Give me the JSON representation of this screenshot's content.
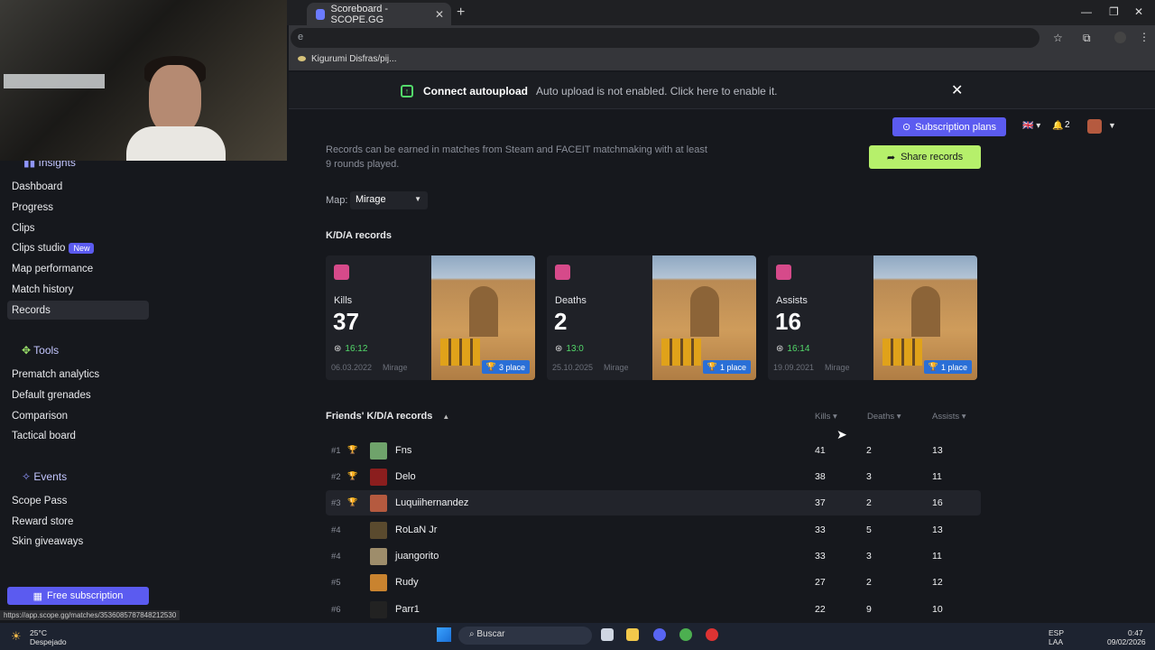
{
  "browser": {
    "tab_title": "Scoreboard - SCOPE.GG",
    "url": "e",
    "bookmark": "Kigurumi Disfras/pij...",
    "status_url": "https://app.scope.gg/matches/3536085787848212530"
  },
  "banner": {
    "title": "Connect autoupload",
    "text": "Auto upload is not enabled. Click here to enable it."
  },
  "header": {
    "subscription_label": "Subscription plans",
    "notifications": "2"
  },
  "sidebar": {
    "insights_label": "Insights",
    "items": [
      "Dashboard",
      "Progress",
      "Clips",
      "Clips studio",
      "Map performance",
      "Match history",
      "Records"
    ],
    "new_badge": "New",
    "tools_label": "Tools",
    "tools": [
      "Prematch analytics",
      "Default grenades",
      "Comparison",
      "Tactical board"
    ],
    "events_label": "Events",
    "events": [
      "Scope Pass",
      "Reward store",
      "Skin giveaways"
    ],
    "free_sub_label": "Free subscription"
  },
  "main": {
    "description": "Records can be earned in matches from Steam and FACEIT matchmaking with at least 9 rounds played.",
    "share_label": "Share records",
    "map_label": "Map:",
    "map_value": "Mirage",
    "kda_title": "K/D/A records",
    "cards": [
      {
        "label": "Kills",
        "value": "37",
        "time": "16:12",
        "date": "06.03.2022",
        "map": "Mirage",
        "place": "3 place",
        "icon_color": "#d64a8a"
      },
      {
        "label": "Deaths",
        "value": "2",
        "time": "13:0",
        "date": "25.10.2025",
        "map": "Mirage",
        "place": "1 place",
        "icon_color": "#d64a8a"
      },
      {
        "label": "Assists",
        "value": "16",
        "time": "16:14",
        "date": "19.09.2021",
        "map": "Mirage",
        "place": "1 place",
        "icon_color": "#d64a8a"
      }
    ],
    "friends_title": "Friends' K/D/A records",
    "columns": [
      "Kills",
      "Deaths",
      "Assists"
    ],
    "friends": [
      {
        "rank": "#1",
        "name": "Fns",
        "kills": "41",
        "deaths": "2",
        "assists": "13"
      },
      {
        "rank": "#2",
        "name": "Delo",
        "kills": "38",
        "deaths": "3",
        "assists": "11"
      },
      {
        "rank": "#3",
        "name": "Luquiihernandez",
        "kills": "37",
        "deaths": "2",
        "assists": "16"
      },
      {
        "rank": "#4",
        "name": "RoLaN Jr",
        "kills": "33",
        "deaths": "5",
        "assists": "13"
      },
      {
        "rank": "#4",
        "name": "juangorito",
        "kills": "33",
        "deaths": "3",
        "assists": "11"
      },
      {
        "rank": "#5",
        "name": "Rudy",
        "kills": "27",
        "deaths": "2",
        "assists": "12"
      },
      {
        "rank": "#6",
        "name": "Parr1",
        "kills": "22",
        "deaths": "9",
        "assists": "10"
      }
    ]
  },
  "taskbar": {
    "weather_temp": "25°C",
    "weather_desc": "Despejado",
    "search": "Buscar",
    "lang1": "ESP",
    "lang2": "LAA",
    "time": "0:47",
    "date": "09/02/2026"
  }
}
